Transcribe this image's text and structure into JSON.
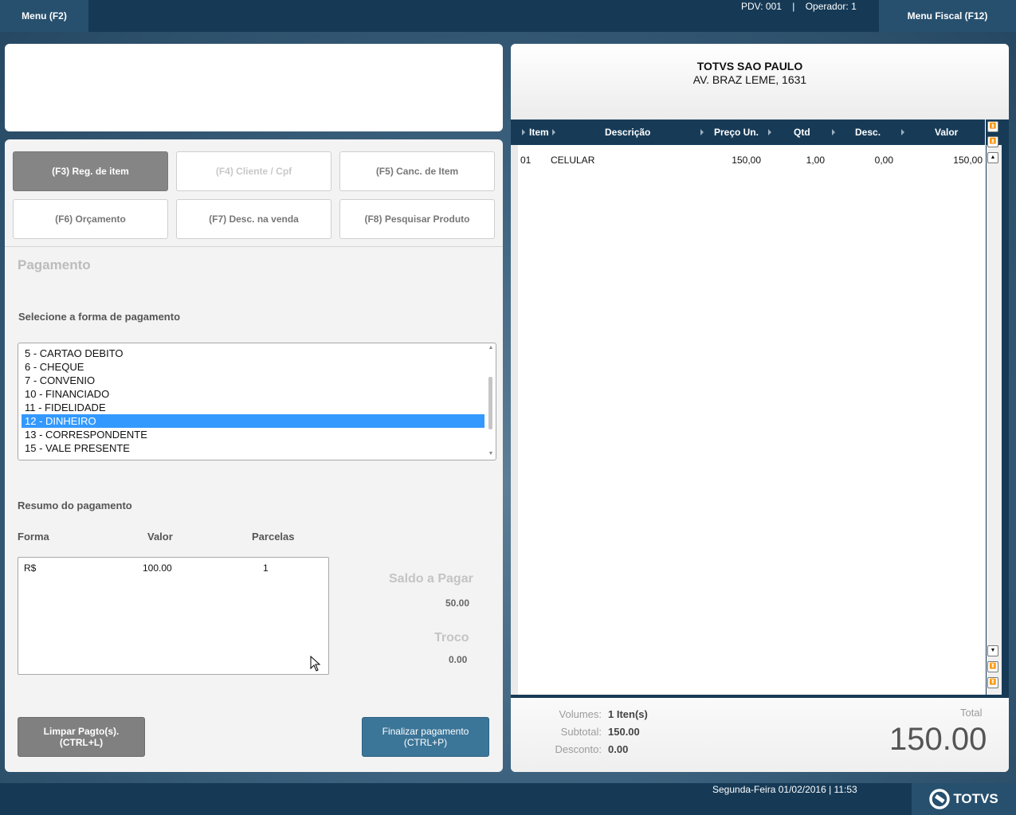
{
  "topbar": {
    "menu_label": "Menu (F2)",
    "pdv_info": "PDV: 001    |    Operador: 1",
    "fiscal_label": "Menu Fiscal (F12)"
  },
  "functions": [
    {
      "label": "(F3) Reg. de item"
    },
    {
      "label": "(F4) Cliente / Cpf"
    },
    {
      "label": "(F5) Canc. de Item"
    },
    {
      "label": "(F6) Orçamento"
    },
    {
      "label": "(F7) Desc. na venda"
    },
    {
      "label": "(F8) Pesquisar Produto"
    }
  ],
  "payment": {
    "title": "Pagamento",
    "select_label": "Selecione a forma de pagamento",
    "options": [
      "5 - CARTAO DEBITO",
      "6 - CHEQUE",
      "7 - CONVENIO",
      "10 - FINANCIADO",
      "11 - FIDELIDADE",
      "12 - DINHEIRO",
      "13 - CORRESPONDENTE",
      "15 - VALE PRESENTE"
    ],
    "selected": "12 - DINHEIRO",
    "resumo_label": "Resumo do pagamento",
    "columns": [
      "Forma",
      "Valor",
      "Parcelas"
    ],
    "rows": [
      {
        "forma": "R$",
        "valor": "100.00",
        "parcelas": "1"
      }
    ],
    "saldo_label": "Saldo a Pagar",
    "saldo_value": "50.00",
    "troco_label": "Troco",
    "troco_value": "0.00",
    "limpar_line1": "Limpar Pagto(s).",
    "limpar_line2": "(CTRL+L)",
    "finalizar_line1": "Finalizar pagamento",
    "finalizar_line2": "(CTRL+P)"
  },
  "receipt": {
    "store_name": "TOTVS SAO PAULO",
    "store_address": "AV. BRAZ LEME, 1631",
    "columns": [
      "Item",
      "Descrição",
      "Preço Un.",
      "Qtd",
      "Desc.",
      "Valor"
    ],
    "items": [
      {
        "item": "01",
        "descricao": "CELULAR",
        "preco": "150,00",
        "qtd": "1,00",
        "desc": "0,00",
        "valor": "150,00"
      }
    ],
    "volumes_label": "Volumes:",
    "volumes_value": "1 Iten(s)",
    "subtotal_label": "Subtotal:",
    "subtotal_value": "150.00",
    "desconto_label": "Desconto:",
    "desconto_value": "0.00",
    "total_label": "Total",
    "total_value": "150.00"
  },
  "footer": {
    "datetime": "Segunda-Feira 01/02/2016 | 11:53",
    "logo_text": "TOTVS"
  },
  "colors": {
    "dark_bar": "#163a56",
    "selection": "#3399ff",
    "primary_button": "#3b7598"
  }
}
